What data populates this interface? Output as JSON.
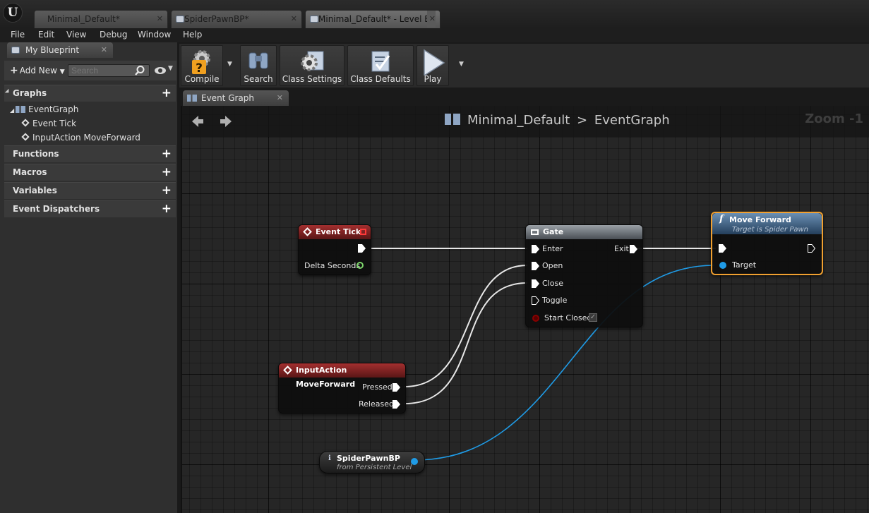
{
  "tabs": [
    {
      "label": "Minimal_Default*"
    },
    {
      "label": "SpiderPawnBP*"
    },
    {
      "label": "Minimal_Default* - Level B"
    }
  ],
  "menu": [
    "File",
    "Edit",
    "View",
    "Debug",
    "Window",
    "Help"
  ],
  "left_panel": {
    "tab_title": "My Blueprint",
    "add_new_label": "Add New",
    "search_placeholder": "Search",
    "sections": {
      "graphs": "Graphs",
      "functions": "Functions",
      "macros": "Macros",
      "variables": "Variables",
      "event_dispatchers": "Event Dispatchers"
    },
    "tree": {
      "event_graph": "EventGraph",
      "event_tick": "Event Tick",
      "input_action": "InputAction MoveForward"
    }
  },
  "toolbar": {
    "compile": "Compile",
    "search": "Search",
    "class_settings": "Class Settings",
    "class_defaults": "Class Defaults",
    "play": "Play"
  },
  "graph_tab": "Event Graph",
  "breadcrumb": {
    "root": "Minimal_Default",
    "separator": ">",
    "current": "EventGraph"
  },
  "zoom": "Zoom -1",
  "nodes": {
    "event_tick": {
      "title": "Event Tick",
      "delta": "Delta Seconds"
    },
    "gate": {
      "title": "Gate",
      "enter": "Enter",
      "exit": "Exit",
      "open": "Open",
      "close": "Close",
      "toggle": "Toggle",
      "start_closed": "Start Closed"
    },
    "move_forward": {
      "title": "Move Forward",
      "subtitle": "Target is Spider Pawn",
      "target": "Target"
    },
    "input_action": {
      "title": "InputAction MoveForward",
      "pressed": "Pressed",
      "released": "Released"
    },
    "spider_pawn": {
      "title": "SpiderPawnBP",
      "subtitle": "from Persistent Level"
    }
  },
  "colors": {
    "event_header": "#a32f2f",
    "function_header": "#3f6a92",
    "object_pin": "#1f9be6",
    "float_pin": "#7cd36a",
    "selection": "#f0a030"
  }
}
